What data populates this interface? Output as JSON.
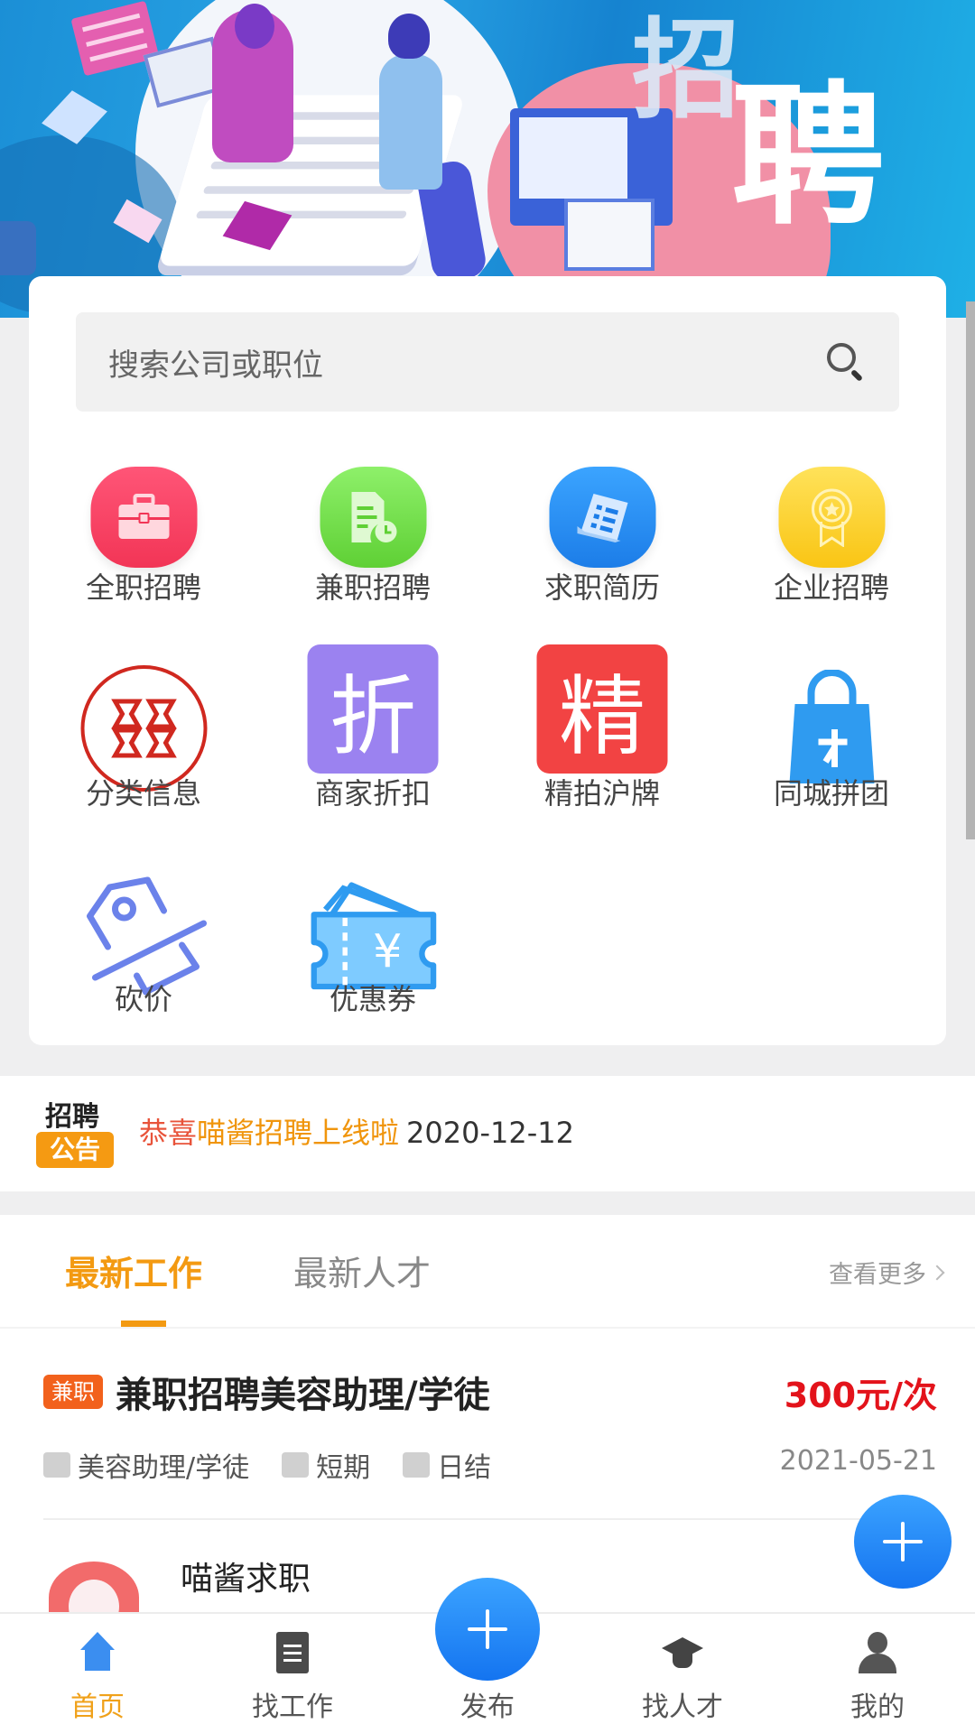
{
  "banner": {
    "title_chars": [
      "招",
      "聘"
    ]
  },
  "search": {
    "placeholder": "搜索公司或职位",
    "icon": "search-icon"
  },
  "categories": [
    {
      "label": "全职招聘",
      "icon": "briefcase-icon",
      "color": "#f23556"
    },
    {
      "label": "兼职招聘",
      "icon": "document-clock-icon",
      "color": "#5fd035"
    },
    {
      "label": "求职简历",
      "icon": "resume-icon",
      "color": "#1c7de8"
    },
    {
      "label": "企业招聘",
      "icon": "medal-icon",
      "color": "#f9c514"
    },
    {
      "label": "分类信息",
      "icon": "clover-icon",
      "color": "#d0281f"
    },
    {
      "label": "商家折扣",
      "icon": "discount-icon",
      "glyph": "折",
      "color": "#9b82f0"
    },
    {
      "label": "精拍沪牌",
      "icon": "license-plate-icon",
      "glyph": "精",
      "color": "#f24343"
    },
    {
      "label": "同城拼团",
      "icon": "shopping-bag-icon",
      "color": "#2f9bf0"
    },
    {
      "label": "砍价",
      "icon": "price-tag-cut-icon",
      "color": "#6b82ea"
    },
    {
      "label": "优惠券",
      "icon": "coupon-icon",
      "glyph": "¥",
      "color": "#2f9bf0"
    }
  ],
  "notice": {
    "title": "招聘",
    "badge": "公告",
    "text_part1": "恭喜",
    "text_part2": "喵酱招聘上线啦",
    "date": "2020-12-12"
  },
  "feed": {
    "tabs": [
      {
        "label": "最新工作",
        "active": true
      },
      {
        "label": "最新人才",
        "active": false
      }
    ],
    "more_label": "查看更多",
    "jobs": [
      {
        "badge": "兼职",
        "title": "兼职招聘美容助理/学徒",
        "price": "300元/次",
        "position": "美容助理/学徒",
        "duration": "短期",
        "settlement": "日结",
        "date": "2021-05-21"
      }
    ],
    "people": [
      {
        "name": "喵酱求职"
      }
    ]
  },
  "fab": {
    "icon": "plus-icon"
  },
  "tabbar": {
    "items": [
      {
        "label": "首页",
        "icon": "home-icon",
        "active": true
      },
      {
        "label": "找工作",
        "icon": "document-icon",
        "active": false
      },
      {
        "label": "发布",
        "icon": "plus-icon",
        "active": false
      },
      {
        "label": "找人才",
        "icon": "graduation-cap-icon",
        "active": false
      },
      {
        "label": "我的",
        "icon": "user-icon",
        "active": false
      }
    ]
  }
}
